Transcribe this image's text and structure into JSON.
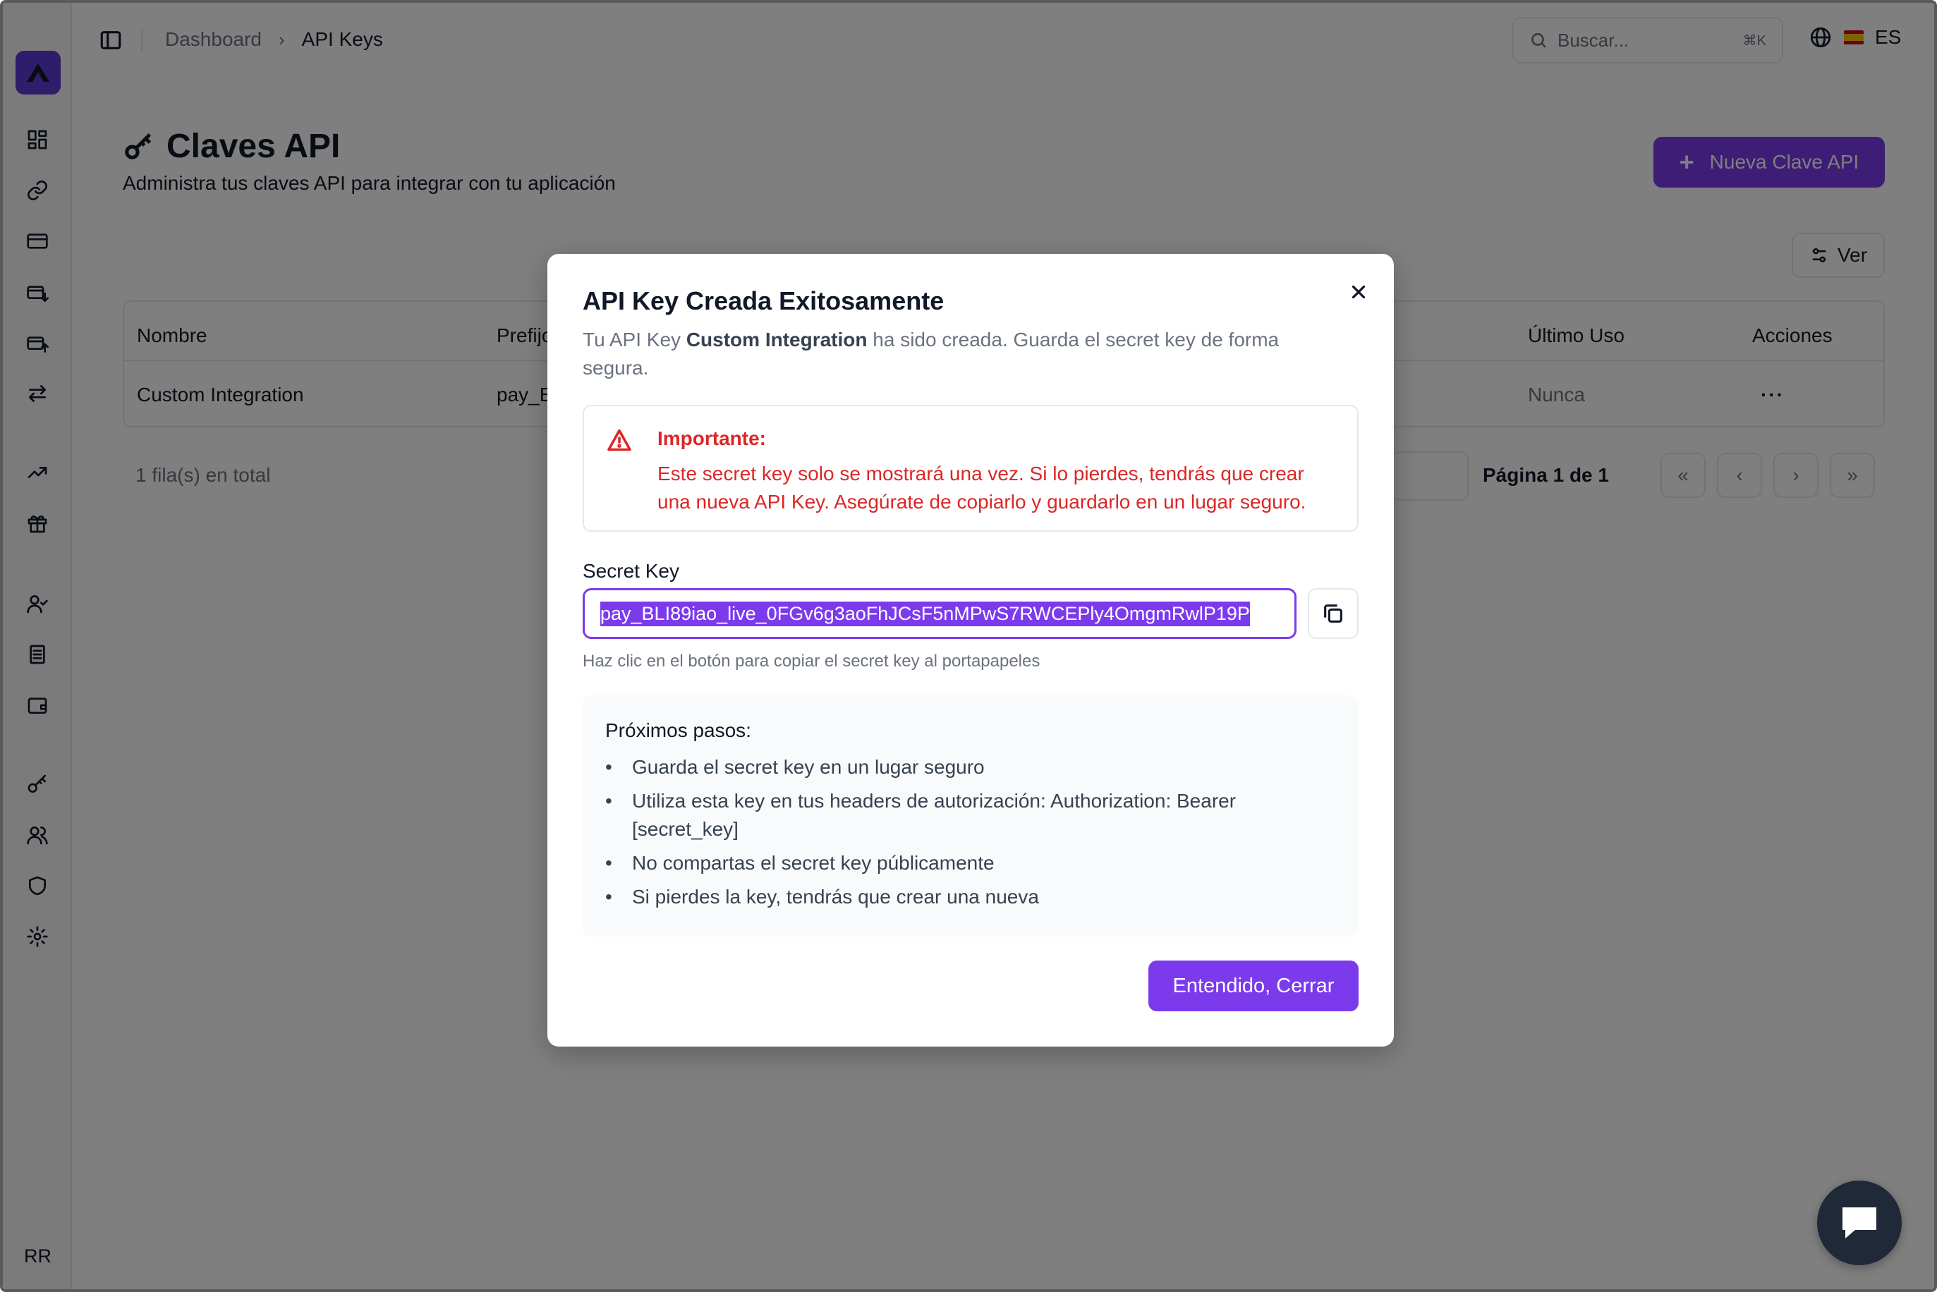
{
  "header": {
    "breadcrumb": [
      "Dashboard",
      "API Keys"
    ],
    "search_placeholder": "Buscar...",
    "search_shortcut": "⌘K",
    "language": "ES"
  },
  "sidebar": {
    "user_initials": "RR",
    "icons": [
      "dashboard-icon",
      "link-icon",
      "credit-card-icon",
      "card-in-icon",
      "card-out-icon",
      "transfer-icon",
      "trending-up-icon",
      "gift-icon",
      "user-check-icon",
      "document-icon",
      "wallet-icon",
      "key-icon",
      "users-icon",
      "shield-icon",
      "settings-icon"
    ]
  },
  "page": {
    "title": "Claves API",
    "subtitle": "Administra tus claves API para integrar con tu aplicación",
    "new_button": "Nueva Clave API",
    "view_button": "Ver"
  },
  "table": {
    "headers": [
      "Nombre",
      "Prefijo",
      "Último Uso",
      "Acciones"
    ],
    "rows": [
      {
        "nombre": "Custom Integration",
        "prefijo": "pay_E",
        "ultimo_uso": "Nunca",
        "acciones": "···"
      }
    ],
    "row_count": "1 fila(s) en total",
    "page_info": "Página 1 de 1",
    "pagination": [
      "«",
      "‹",
      "›",
      "»"
    ]
  },
  "modal": {
    "title": "API Key Creada Exitosamente",
    "desc_pre": "Tu API Key ",
    "desc_name": "Custom Integration",
    "desc_post": " ha sido creada. Guarda el secret key de forma segura.",
    "warning_title": "Importante:",
    "warning_text": "Este secret key solo se mostrará una vez. Si lo pierdes, tendrás que crear una nueva API Key. Asegúrate de copiarlo y guardarlo en un lugar seguro.",
    "secret_label": "Secret Key",
    "secret_value": "pay_BLI89iao_live_0FGv6g3aoFhJCsF5nMPwS7RWCEPly4OmgmRwlP19P",
    "secret_help": "Haz clic en el botón para copiar el secret key al portapapeles",
    "steps_title": "Próximos pasos:",
    "steps": [
      "Guarda el secret key en un lugar seguro",
      "Utiliza esta key en tus headers de autorización: Authorization: Bearer [secret_key]",
      "No compartas el secret key públicamente",
      "Si pierdes la key, tendrás que crear una nueva"
    ],
    "confirm_button": "Entendido, Cerrar"
  },
  "colors": {
    "accent": "#7c3aed",
    "danger": "#dc2626",
    "logo": "#5b3bd6"
  }
}
